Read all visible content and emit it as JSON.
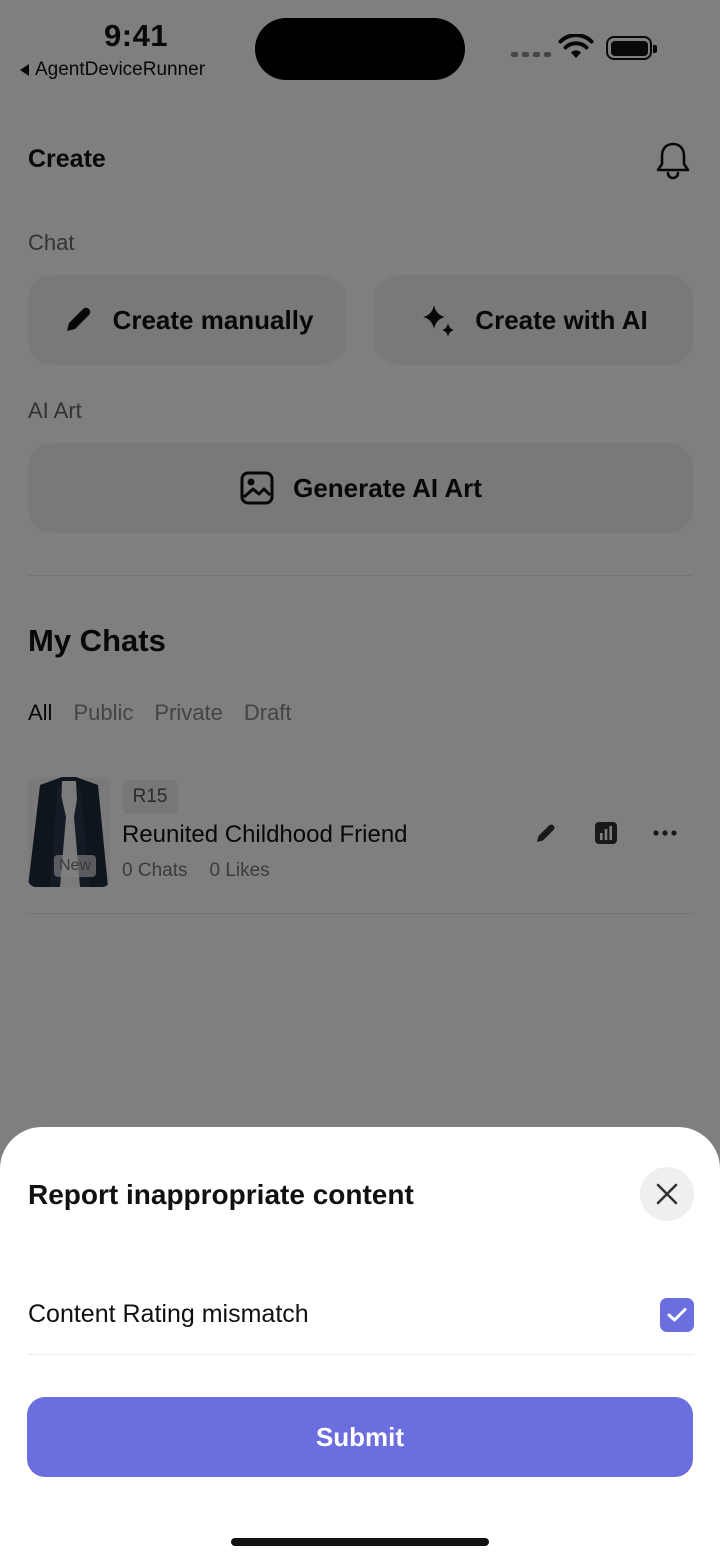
{
  "status_bar": {
    "time": "9:41",
    "back_app": "AgentDeviceRunner"
  },
  "header": {
    "title": "Create",
    "notification_icon": "bell-icon"
  },
  "chat_section": {
    "label": "Chat",
    "create_manually": {
      "label": "Create manually",
      "icon": "pencil-icon"
    },
    "create_with_ai": {
      "label": "Create with AI",
      "icon": "sparkles-icon"
    }
  },
  "ai_art_section": {
    "label": "AI Art",
    "generate": {
      "label": "Generate AI Art",
      "icon": "image-icon"
    }
  },
  "my_chats": {
    "title": "My Chats",
    "tabs": [
      {
        "label": "All",
        "active": true
      },
      {
        "label": "Public",
        "active": false
      },
      {
        "label": "Private",
        "active": false
      },
      {
        "label": "Draft",
        "active": false
      }
    ],
    "items": [
      {
        "rating": "R15",
        "title": "Reunited Childhood Friend",
        "chats": "0 Chats",
        "likes": "0 Likes",
        "new_tag": "New"
      }
    ]
  },
  "report_sheet": {
    "title": "Report inappropriate content",
    "option": {
      "label": "Content Rating mismatch",
      "checked": true
    },
    "submit_label": "Submit"
  },
  "colors": {
    "accent": "#6b6edf",
    "tile_bg": "#f2f2f2",
    "overlay": "rgba(0,0,0,0.5)"
  }
}
